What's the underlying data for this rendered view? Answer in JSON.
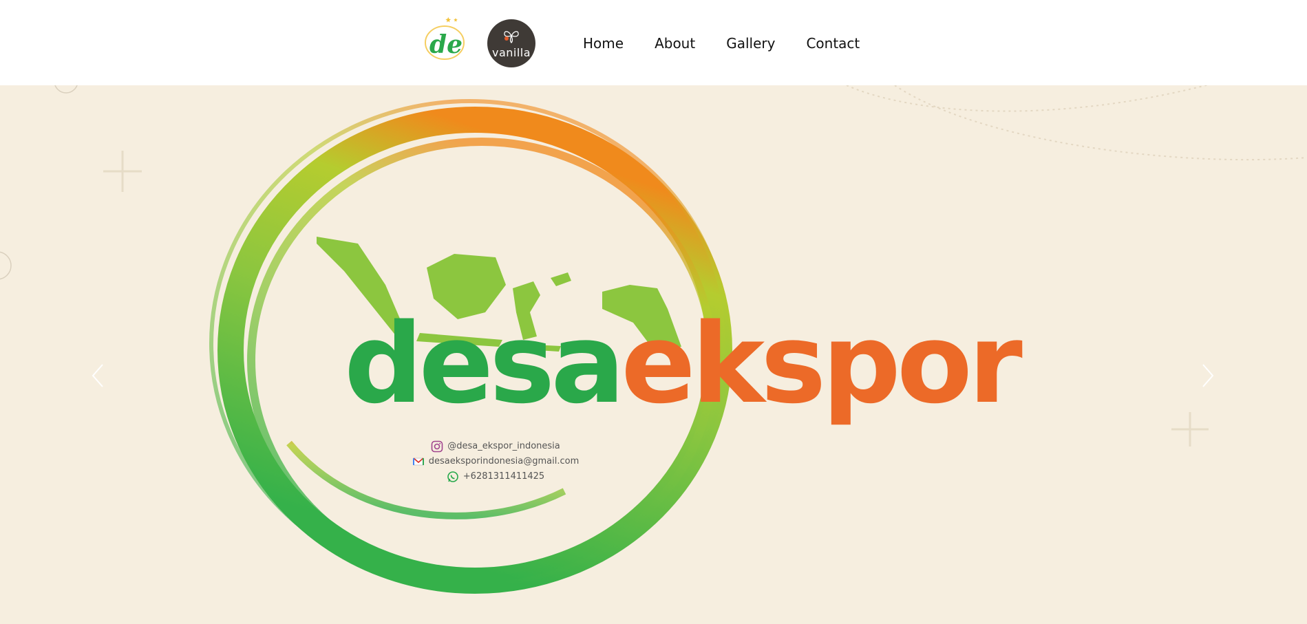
{
  "nav": {
    "logo_de_text": "de",
    "logo_vanilla_text": "vanilla",
    "links": [
      "Home",
      "About",
      "Gallery",
      "Contact"
    ]
  },
  "hero": {
    "brand_part1": "desa",
    "brand_part2": "ekspor",
    "contacts": {
      "instagram": "@desa_ekspor_indonesia",
      "email": "desaeksporindonesia@gmail.com",
      "whatsapp": "+6281311411425"
    },
    "icons": [
      "instagram-icon",
      "gmail-icon",
      "whatsapp-icon",
      "chevron-left-icon",
      "chevron-right-icon"
    ]
  },
  "colors": {
    "hero_background": "#f6eedf",
    "brand_green": "#2aa84a",
    "brand_orange": "#ec6a28",
    "vanilla_logo_bg": "#3f3a36"
  }
}
